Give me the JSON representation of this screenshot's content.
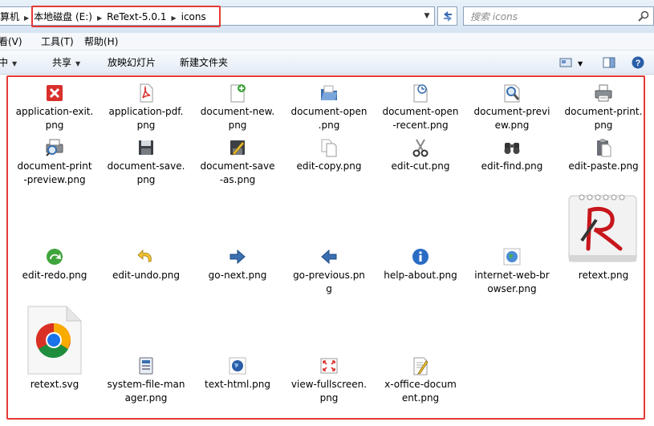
{
  "address": {
    "prefix": "算机",
    "segments": [
      "本地磁盘 (E:)",
      "ReText-5.0.1",
      "icons"
    ]
  },
  "search": {
    "placeholder": "搜索 icons"
  },
  "menu": [
    "查看(V)",
    "工具(T)",
    "帮助(H)"
  ],
  "toolbar": {
    "items": [
      {
        "label": "库中",
        "has_arrow": true
      },
      {
        "label": "共享",
        "has_arrow": true
      },
      {
        "label": "放映幻灯片",
        "has_arrow": false
      },
      {
        "label": "新建文件夹",
        "has_arrow": false
      }
    ]
  },
  "colors": {
    "highlight": "#e53935",
    "accent": "#2a5ea8"
  },
  "files": [
    {
      "name": "application-exit.\npng",
      "icon": "exit-icon"
    },
    {
      "name": "application-pdf.\npng",
      "icon": "pdf-icon"
    },
    {
      "name": "document-new.\npng",
      "icon": "document-new-icon"
    },
    {
      "name": "document-open\n.png",
      "icon": "folder-open-icon"
    },
    {
      "name": "document-open\n-recent.png",
      "icon": "document-recent-icon"
    },
    {
      "name": "document-previ\new.png",
      "icon": "magnifier-icon"
    },
    {
      "name": "document-print.\npng",
      "icon": "printer-icon"
    },
    {
      "name": "document-print\n-preview.png",
      "icon": "print-preview-icon"
    },
    {
      "name": "document-save.\npng",
      "icon": "floppy-icon"
    },
    {
      "name": "document-save\n-as.png",
      "icon": "save-as-icon"
    },
    {
      "name": "edit-copy.png",
      "icon": "copy-icon"
    },
    {
      "name": "edit-cut.png",
      "icon": "scissors-icon"
    },
    {
      "name": "edit-find.png",
      "icon": "binoculars-icon"
    },
    {
      "name": "edit-paste.png",
      "icon": "clipboard-icon"
    },
    {
      "name": "edit-redo.png",
      "icon": "redo-icon"
    },
    {
      "name": "edit-undo.png",
      "icon": "undo-icon"
    },
    {
      "name": "go-next.png",
      "icon": "arrow-right-icon"
    },
    {
      "name": "go-previous.pn\ng",
      "icon": "arrow-left-icon"
    },
    {
      "name": "help-about.png",
      "icon": "info-icon"
    },
    {
      "name": "internet-web-br\nowser.png",
      "icon": "globe-icon"
    },
    {
      "name": "retext.png",
      "icon": "retext-logo-icon"
    },
    {
      "name": "retext.svg",
      "icon": "chrome-file-icon"
    },
    {
      "name": "system-file-man\nager.png",
      "icon": "file-manager-icon"
    },
    {
      "name": "text-html.png",
      "icon": "html-icon"
    },
    {
      "name": "view-fullscreen.\npng",
      "icon": "fullscreen-icon"
    },
    {
      "name": "x-office-docum\nent.png",
      "icon": "office-document-icon"
    }
  ]
}
